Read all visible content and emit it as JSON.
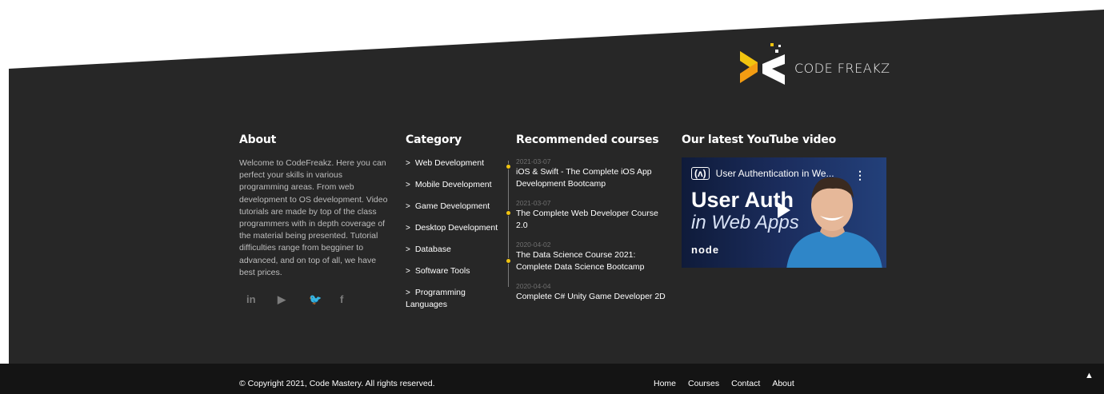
{
  "brand": {
    "name": "CODE FREAKZ"
  },
  "about": {
    "heading": "About",
    "text": "Welcome to CodeFreakz. Here you can perfect your skills in various programming areas. From web development to OS development. Video tutorials are made by top of the class programmers with in depth coverage of the material being presented. Tutorial difficulties range from begginer to advanced, and on top of all, we have best prices.",
    "social": [
      {
        "icon": "linkedin-icon",
        "glyph": "in"
      },
      {
        "icon": "youtube-icon",
        "glyph": "▶"
      },
      {
        "icon": "twitter-icon",
        "glyph": "🐦"
      },
      {
        "icon": "facebook-icon",
        "glyph": "f"
      }
    ]
  },
  "category": {
    "heading": "Category",
    "items": [
      "Web Development",
      "Mobile Development",
      "Game Development",
      "Desktop Development",
      "Database",
      "Software Tools",
      "Programming Languages"
    ]
  },
  "courses": {
    "heading": "Recommended courses",
    "items": [
      {
        "date": "2021-03-07",
        "title": "iOS & Swift - The Complete iOS App Development Bootcamp"
      },
      {
        "date": "2021-03-07",
        "title": "The Complete Web Developer Course 2.0"
      },
      {
        "date": "2020-04-02",
        "title": "The Data Science Course 2021: Complete Data Science Bootcamp"
      },
      {
        "date": "2020-04-04",
        "title": "Complete C# Unity Game Developer 2D"
      }
    ]
  },
  "youtube": {
    "heading": "Our latest YouTube video",
    "video_title": "User Authentication in We...",
    "badge": "(ʌ)",
    "thumb_line1": "User Auth",
    "thumb_line2": "in Web Apps",
    "thumb_logo": "node"
  },
  "footer": {
    "copyright": "© Copyright 2021, Code Mastery. All rights reserved.",
    "nav": [
      "Home",
      "Courses",
      "Contact",
      "About"
    ],
    "to_top": "🡑"
  },
  "colors": {
    "footer_bg": "#272727",
    "bottom_bar_bg": "#141414",
    "accent": "#f1c40f",
    "logo_orange": "#f39c12",
    "logo_yellow": "#f1c40f"
  }
}
